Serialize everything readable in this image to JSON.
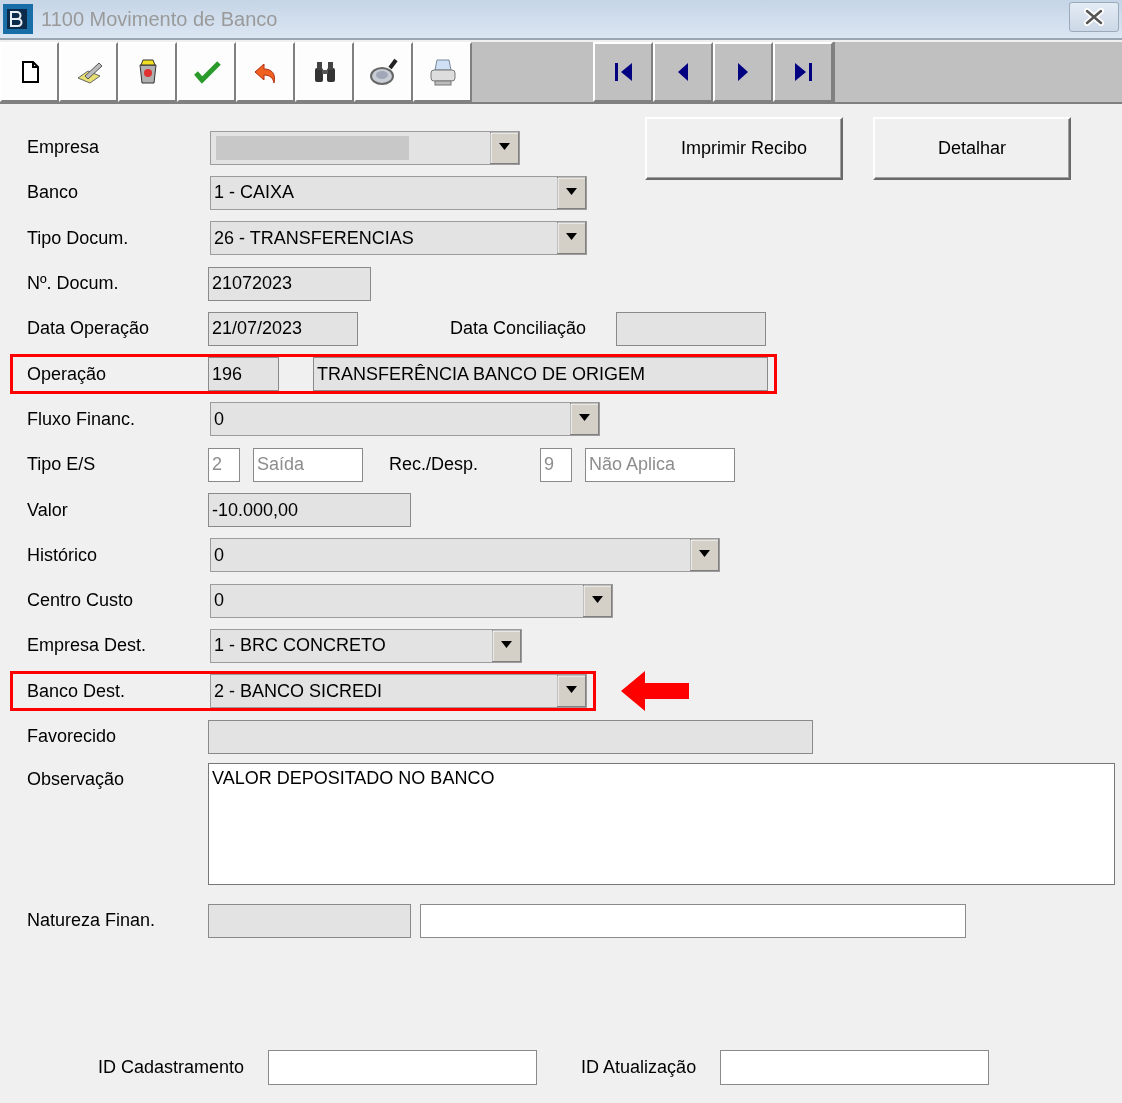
{
  "window": {
    "title": "1100 Movimento de Banco"
  },
  "buttons": [
    {
      "label": "Imprimir Recibo"
    },
    {
      "label": "Detalhar"
    }
  ],
  "rows": [
    {
      "label": "Empresa",
      "fields": [
        {
          "kind": "combo",
          "redacted": true
        }
      ]
    },
    {
      "label": "Banco",
      "fields": [
        {
          "kind": "combo",
          "value": "1 - CAIXA"
        }
      ]
    },
    {
      "label": "Tipo Docum.",
      "fields": [
        {
          "kind": "combo",
          "value": "26 - TRANSFERENCIAS"
        }
      ]
    },
    {
      "label": "Nº. Docum.",
      "fields": [
        {
          "kind": "text",
          "value": "21072023",
          "readonly": true
        }
      ]
    },
    {
      "label": "Data Operação",
      "fields": [
        {
          "kind": "text",
          "value": "21/07/2023",
          "readonly": true
        },
        {
          "kind": "label",
          "text": "Data Conciliação"
        },
        {
          "kind": "text",
          "readonly": true
        }
      ]
    },
    {
      "label": "Operação",
      "highlighted": true,
      "fields": [
        {
          "kind": "text",
          "value": "196",
          "readonly": true
        },
        {
          "kind": "text",
          "value": "TRANSFERÊNCIA BANCO DE ORIGEM",
          "readonly": true
        }
      ]
    },
    {
      "label": "Fluxo Financ.",
      "fields": [
        {
          "kind": "combo",
          "value": "0"
        }
      ]
    },
    {
      "label": "Tipo E/S",
      "fields": [
        {
          "kind": "text",
          "value": "2",
          "readonly": false,
          "disabled": true
        },
        {
          "kind": "text",
          "value": "Saída",
          "readonly": false,
          "disabled": true
        },
        {
          "kind": "label",
          "text": "Rec./Desp."
        },
        {
          "kind": "text",
          "value": "9",
          "readonly": false,
          "disabled": true
        },
        {
          "kind": "text",
          "value": "Não Aplica",
          "readonly": false,
          "disabled": true
        }
      ]
    },
    {
      "label": "Valor",
      "fields": [
        {
          "kind": "text",
          "value": "-10.000,00",
          "readonly": true
        }
      ]
    },
    {
      "label": "Histórico",
      "fields": [
        {
          "kind": "combo",
          "value": "0"
        }
      ]
    },
    {
      "label": "Centro Custo",
      "fields": [
        {
          "kind": "combo",
          "value": "0"
        }
      ]
    },
    {
      "label": "Empresa Dest.",
      "fields": [
        {
          "kind": "combo",
          "value": "1 - BRC CONCRETO"
        }
      ]
    },
    {
      "label": "Banco Dest.",
      "highlighted": true,
      "pointer_arrow": true,
      "fields": [
        {
          "kind": "combo",
          "value": "2 - BANCO SICREDI"
        }
      ]
    },
    {
      "label": "Favorecido",
      "fields": [
        {
          "kind": "text",
          "readonly": true
        }
      ]
    },
    {
      "label": "Observação",
      "fields": [
        {
          "kind": "memo",
          "value": "VALOR DEPOSITADO NO BANCO",
          "readonly": false
        }
      ]
    },
    {
      "label": "Natureza Finan.",
      "fields": [
        {
          "kind": "text",
          "readonly": true
        },
        {
          "kind": "text",
          "readonly": false
        }
      ]
    }
  ],
  "footer": [
    {
      "label": "ID Cadastramento"
    },
    {
      "label": "ID Atualização"
    }
  ]
}
